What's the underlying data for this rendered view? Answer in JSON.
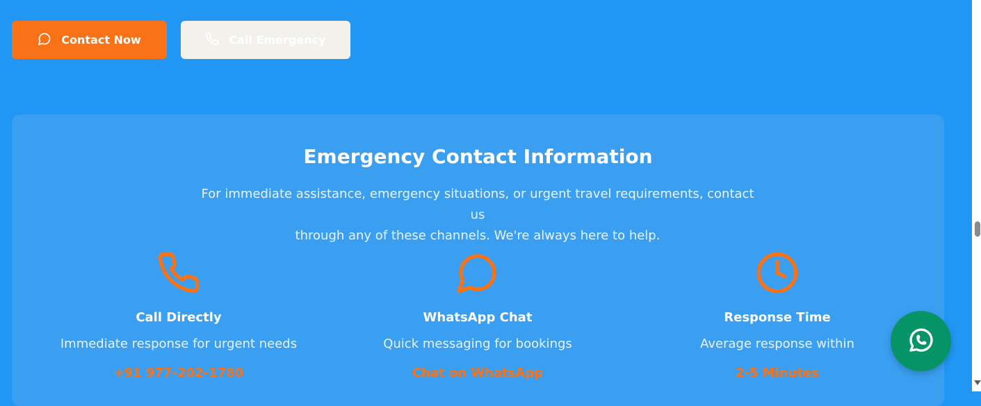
{
  "buttons": {
    "contact_label": "Contact Now",
    "call_label": "Call Emergency"
  },
  "card": {
    "title": "Emergency Contact Information",
    "description_line1": "For immediate assistance, emergency situations, or urgent travel requirements, contact us",
    "description_line2": "through any of these channels. We're always here to help."
  },
  "channels": [
    {
      "icon": "phone-icon",
      "title": "Call Directly",
      "desc": "Immediate response for urgent needs",
      "link": "+91 977-202-1780"
    },
    {
      "icon": "chat-icon",
      "title": "WhatsApp Chat",
      "desc": "Quick messaging for bookings",
      "link": "Chat on WhatsApp"
    },
    {
      "icon": "clock-icon",
      "title": "Response Time",
      "desc": "Average response within",
      "link": "2-5 Minutes"
    }
  ],
  "colors": {
    "background": "#2196f3",
    "card": "#3b9ff1",
    "accent": "#f97316",
    "whatsapp": "#069466"
  }
}
